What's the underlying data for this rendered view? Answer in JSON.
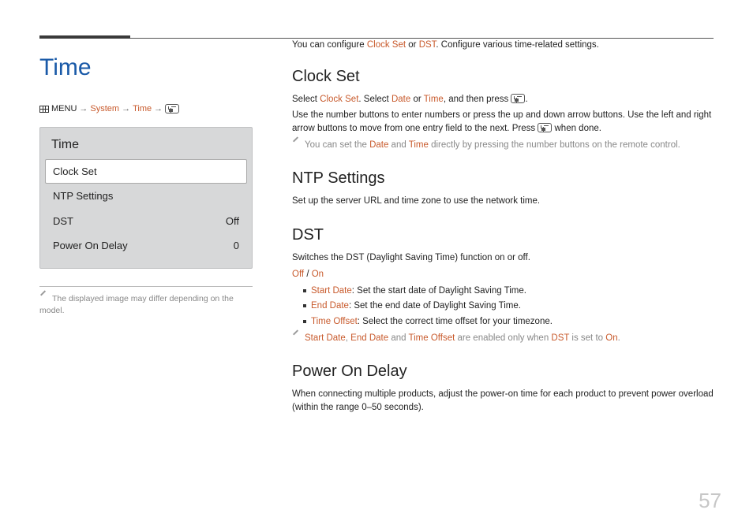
{
  "page_number": "57",
  "left": {
    "title": "Time",
    "crumb": {
      "menu": "MENU",
      "system": "System",
      "time": "Time"
    },
    "panel": {
      "title": "Time",
      "items": [
        {
          "label": "Clock Set",
          "value": "",
          "selected": true
        },
        {
          "label": "NTP Settings",
          "value": "",
          "selected": false
        },
        {
          "label": "DST",
          "value": "Off",
          "selected": false
        },
        {
          "label": "Power On Delay",
          "value": "0",
          "selected": false
        }
      ]
    },
    "disclaimer": "The displayed image may differ depending on the model."
  },
  "right": {
    "intro": {
      "pre": "You can configure ",
      "a": "Clock Set",
      "mid": " or ",
      "b": "DST",
      "post": ". Configure various time-related settings."
    },
    "clock_set": {
      "heading": "Clock Set",
      "l1": {
        "pre": "Select ",
        "a": "Clock Set",
        "mid1": ". Select ",
        "b": "Date",
        "mid2": " or ",
        "c": "Time",
        "post": ", and then press ",
        "tail": "."
      },
      "l2": "Use the number buttons to enter numbers or press the up and down arrow buttons. Use the left and right arrow buttons to move from one entry field to the next. Press ",
      "l2_tail": " when done.",
      "tip": {
        "pre": "You can set the ",
        "a": "Date",
        "mid": " and ",
        "b": "Time",
        "post": " directly by pressing the number buttons on the remote control."
      }
    },
    "ntp": {
      "heading": "NTP Settings",
      "body": "Set up the server URL and time zone to use the network time."
    },
    "dst": {
      "heading": "DST",
      "body": "Switches the DST (Daylight Saving Time) function on or off.",
      "opt_off": "Off",
      "opt_sep": " / ",
      "opt_on": "On",
      "items": [
        {
          "k": "Start Date",
          "v": ": Set the start date of Daylight Saving Time."
        },
        {
          "k": "End Date",
          "v": ": Set the end date of Daylight Saving Time."
        },
        {
          "k": "Time Offset",
          "v": ": Select the correct time offset for your timezone."
        }
      ],
      "tip": {
        "a": "Start Date",
        "b": "End Date",
        "mid1": ", ",
        "mid2": " and ",
        "c": "Time Offset",
        "mid3": " are enabled only when ",
        "d": "DST",
        "mid4": " is set to ",
        "e": "On",
        "tail": "."
      }
    },
    "pod": {
      "heading": "Power On Delay",
      "body": "When connecting multiple products, adjust the power-on time for each product to prevent power overload (within the range 0–50 seconds)."
    }
  }
}
